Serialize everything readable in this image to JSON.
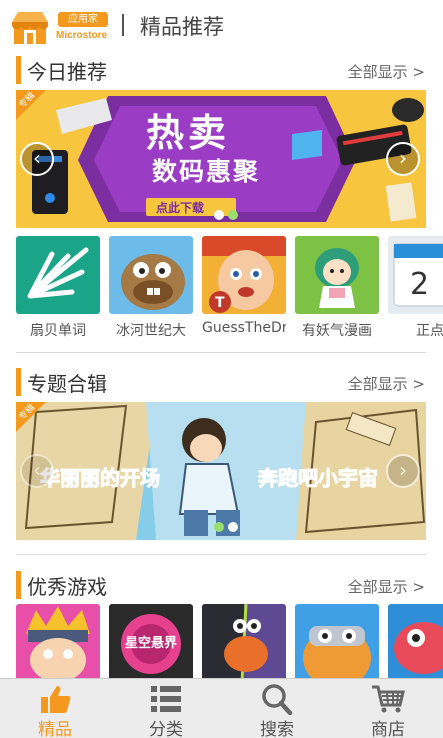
{
  "header": {
    "badge": "应用家",
    "brand": "Microstore",
    "title": "精品推荐"
  },
  "sections": {
    "today": {
      "title": "今日推荐",
      "more": "全部显示 >"
    },
    "topics": {
      "title": "专题合辑",
      "more": "全部显示 >"
    },
    "games": {
      "title": "优秀游戏",
      "more": "全部显示 >"
    }
  },
  "banner1": {
    "tag": "专辑",
    "line1": "热卖",
    "line2": "数码惠聚",
    "button": "点此下载"
  },
  "banner2": {
    "tag": "专辑",
    "left_text": "华丽丽的开场",
    "right_text": "奔跑吧小宇宙"
  },
  "apps": [
    {
      "name": "扇贝单词",
      "color": "#1aa589"
    },
    {
      "name": "冰河世纪大",
      "color": "#5fb5e8"
    },
    {
      "name": "GuessTheDr",
      "color": "#f2b134"
    },
    {
      "name": "有妖气漫画",
      "color": "#79c142"
    },
    {
      "name": "正点",
      "color": "#dfe6ee"
    }
  ],
  "games": [
    {
      "name": "naruto",
      "color": "#e84fa9",
      "label": ""
    },
    {
      "name": "star",
      "color": "#2a2a2a",
      "label": "星空悬界"
    },
    {
      "name": "monster",
      "color": "#5d4a93",
      "label": ""
    },
    {
      "name": "pilot",
      "color": "#3fa0e6",
      "label": ""
    },
    {
      "name": "fish",
      "color": "#e84a5a",
      "label": ""
    }
  ],
  "tabs": [
    {
      "label": "精品",
      "active": true
    },
    {
      "label": "分类",
      "active": false
    },
    {
      "label": "搜索",
      "active": false
    },
    {
      "label": "商店",
      "active": false
    }
  ],
  "colors": {
    "accent": "#f39a1e",
    "active_tab": "#f39a1e"
  }
}
